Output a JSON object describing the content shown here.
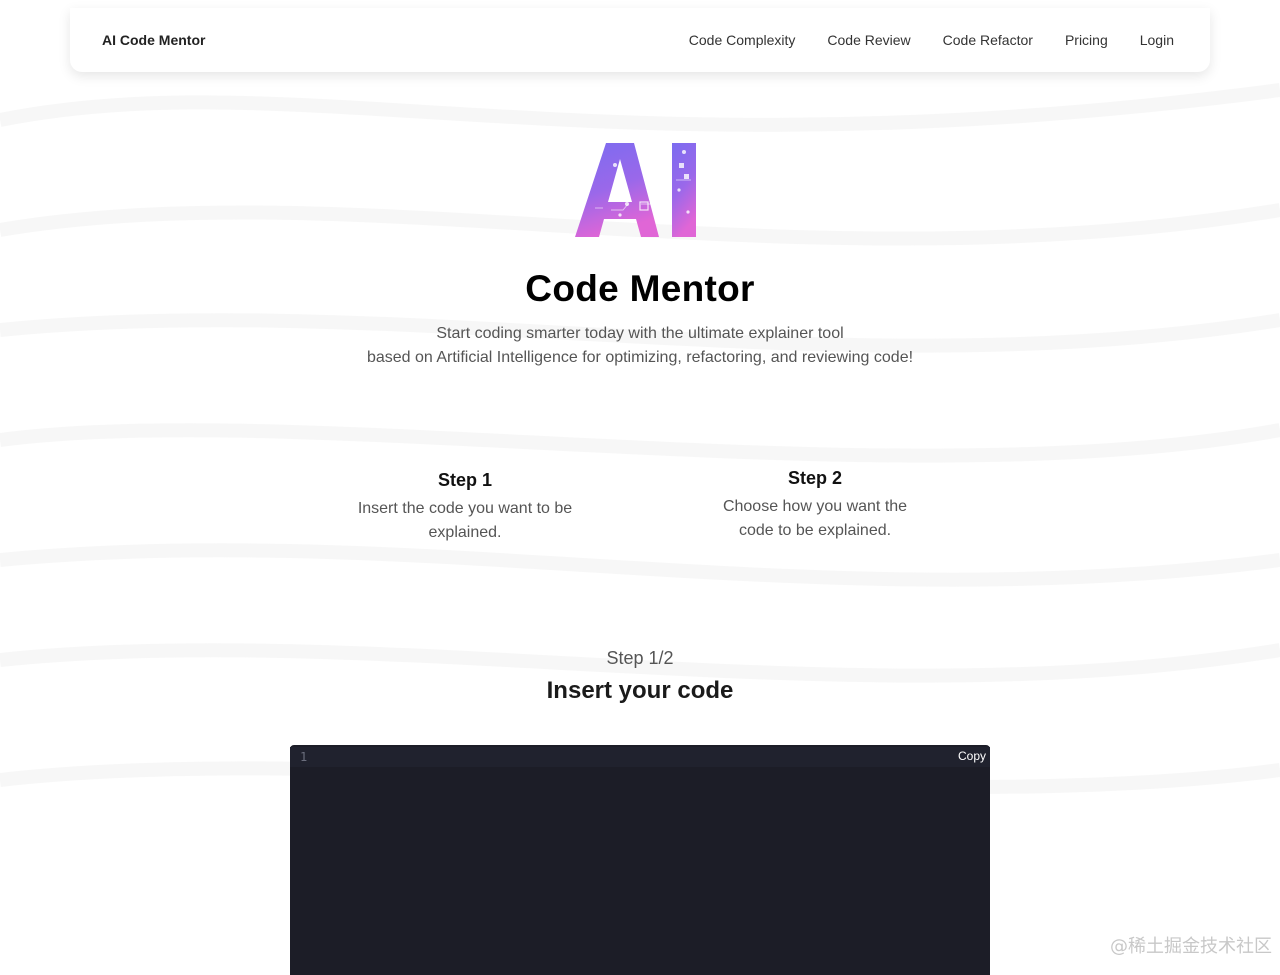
{
  "nav": {
    "brand": "AI Code Mentor",
    "links": [
      "Code Complexity",
      "Code Review",
      "Code Refactor",
      "Pricing",
      "Login"
    ]
  },
  "hero": {
    "logo_text": "AI",
    "title": "Code Mentor",
    "subtitle_line1": "Start coding smarter today with the ultimate explainer tool",
    "subtitle_line2": "based on Artificial Intelligence for optimizing, refactoring, and reviewing code!"
  },
  "steps": [
    {
      "title": "Step 1",
      "line1": "Insert the code you want to be",
      "line2": "explained."
    },
    {
      "title": "Step 2",
      "line1": "Choose how you want the",
      "line2": "code to be explained."
    }
  ],
  "section": {
    "counter": "Step 1/2",
    "title": "Insert your code"
  },
  "editor": {
    "line_number": "1",
    "copy_label": "Copy",
    "content": ""
  },
  "watermark": "@稀土掘金技术社区",
  "colors": {
    "logo_gradient_start": "#7b6cf0",
    "logo_gradient_end": "#e066d6",
    "editor_bg": "#1c1d27"
  }
}
